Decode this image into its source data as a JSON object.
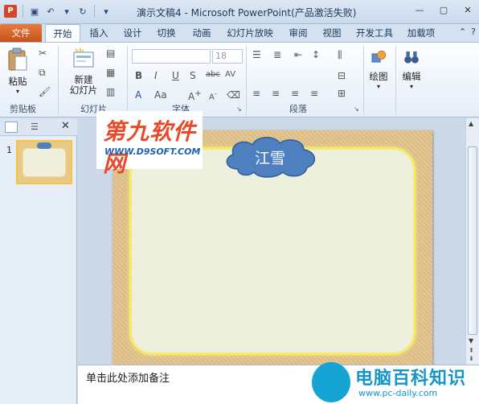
{
  "window": {
    "title": "演示文稿4 - Microsoft PowerPoint(产品激活失败)"
  },
  "ribbon_tabs": [
    "文件",
    "开始",
    "插入",
    "设计",
    "切换",
    "动画",
    "幻灯片放映",
    "审阅",
    "视图",
    "开发工具",
    "加载项"
  ],
  "active_tab": "开始",
  "groups": {
    "clipboard": {
      "label": "剪贴板",
      "paste_label": "粘贴"
    },
    "slides": {
      "label": "幻灯片",
      "new_slide_label": "新建\n幻灯片"
    },
    "font": {
      "label": "字体",
      "size_value": "18"
    },
    "paragraph": {
      "label": "段落"
    },
    "drawing": {
      "label": "绘图"
    },
    "editing": {
      "label": "编辑"
    }
  },
  "left_panel": {
    "slide_number": "1"
  },
  "slide": {
    "cloud_text": "江雪"
  },
  "notes": {
    "placeholder": "单击此处添加备注"
  },
  "watermarks": {
    "top_title": "第九软件网",
    "top_url": "WWW.D9SOFT.COM",
    "bottom_title": "电脑百科知识",
    "bottom_url": "www.pc-daily.com"
  },
  "colors": {
    "file_tab": "#c8531c",
    "cloud": "#4e7fbe",
    "slide_frame": "#f5ea6a"
  }
}
